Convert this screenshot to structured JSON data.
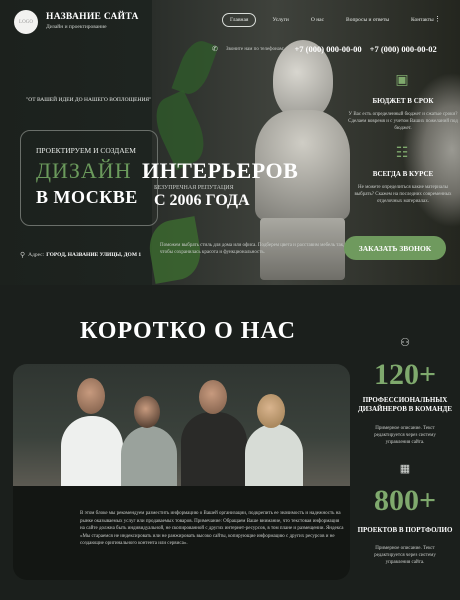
{
  "header": {
    "logo_text": "LOGO",
    "site_name": "НАЗВАНИЕ САЙТА",
    "site_subtitle": "Дизайн и проектирование",
    "nav": [
      "Главная",
      "Услуги",
      "О нас",
      "Вопросы и ответы",
      "Контакты"
    ],
    "more_icon": "⋮"
  },
  "callbar": {
    "text": "Звоните нам по телефонам:",
    "phone1": "+7 (000) 000-00-00",
    "phone2": "+7 (000) 000-00-02"
  },
  "hero": {
    "quote": "\"ОТ ВАШЕЙ ИДЕИ ДО НАШЕГО ВОПЛОЩЕНИЯ\"",
    "pre_title": "ПРОЕКТИРУЕМ И СОЗДАЕМ",
    "title_green": "ДИЗАЙН",
    "title_white": "ИНТЕРЬЕРОВ",
    "title_line2": "В МОСКВЕ",
    "reputation": "БЕЗУПРЕЧНАЯ РЕПУТАЦИЯ",
    "since": "С 2006 ГОДА",
    "description": "Поможем выбрать стиль для дома или офиса. Подберем цвета и расставим мебель так, чтобы сохранилась красота и функциональность.",
    "address_label": "Адрес:",
    "address_value": "ГОРОД, НАЗВАНИЕ УЛИЦЫ, ДОМ 1",
    "cta": "ЗАКАЗАТЬ ЗВОНОК"
  },
  "features": [
    {
      "title": "БЮДЖЕТ В СРОК",
      "text": "У Вас есть определенный бюджет и сжатые сроки? Сделаем вовремя и с учетом Ваших пожеланий под бюджет."
    },
    {
      "title": "ВСЕГДА В КУРСЕ",
      "text": "Не можете определиться какие материалы выбрать? Скажем на последних современных отделочных материалах."
    }
  ],
  "about": {
    "title": "КОРОТКО О НАС",
    "text": "В этом блоке мы рекомендуем разместить информацию о Вашей организации, подкрепить ее значимость и надежность на рынке оказываемых услуг или продаваемых товаров. Примечание: Обращаем Ваше внимание, что текстовая информация на сайте должна быть индивидуальной, не скопированной с других интернет-ресурсов, в том плане и размещении. Яндекса «Мы стараемся не индексировать или не ранжировать высоко сайты, копирующие информацию с других ресурсов и не создающие оригинального контента или сервиса»."
  },
  "stats": [
    {
      "number": "120+",
      "label": "ПРОФЕССИОНАЛЬНЫХ ДИЗАЙНЕРОВ В КОМАНДЕ",
      "text": "Примерное описание. Текст редактируется через систему управления сайта."
    },
    {
      "number": "800+",
      "label": "ПРОЕКТОВ В ПОРТФОЛИО",
      "text": "Примерное описание. Текст редактируется через систему управления сайта."
    }
  ]
}
